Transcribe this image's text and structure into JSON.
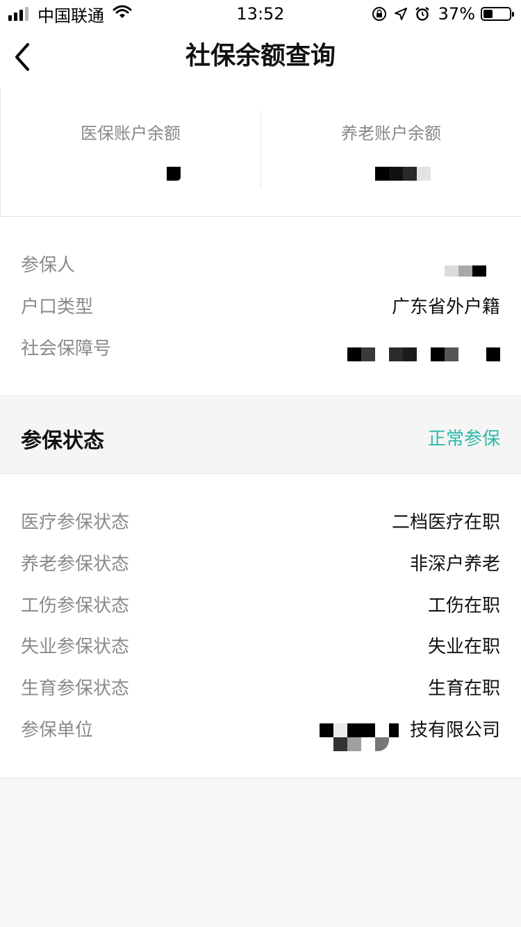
{
  "status_bar": {
    "carrier": "中国联通",
    "time": "13:52",
    "battery": "37%",
    "battery_level": 0.37,
    "icons": [
      "signal-icon",
      "wifi-icon",
      "orientation-lock-icon",
      "location-arrow-icon",
      "alarm-icon",
      "battery-icon"
    ]
  },
  "nav": {
    "title": "社保余额查询",
    "back_icon": "chevron-left-icon"
  },
  "balance": {
    "medical_label": "医保账户余额",
    "pension_label": "养老账户余额"
  },
  "info": {
    "insured_label": "参保人",
    "household_label": "户口类型",
    "household_value": "广东省外户籍",
    "ssn_label": "社会保障号"
  },
  "status": {
    "title": "参保状态",
    "value": "正常参保",
    "value_color": "#2db9a8"
  },
  "details": {
    "rows": [
      {
        "label": "医疗参保状态",
        "value": "二档医疗在职"
      },
      {
        "label": "养老参保状态",
        "value": "非深户养老"
      },
      {
        "label": "工伤参保状态",
        "value": "工伤在职"
      },
      {
        "label": "失业参保状态",
        "value": "失业在职"
      },
      {
        "label": "生育参保状态",
        "value": "生育在职"
      }
    ],
    "unit_label": "参保单位",
    "unit_value_visible": "技有限公司"
  }
}
